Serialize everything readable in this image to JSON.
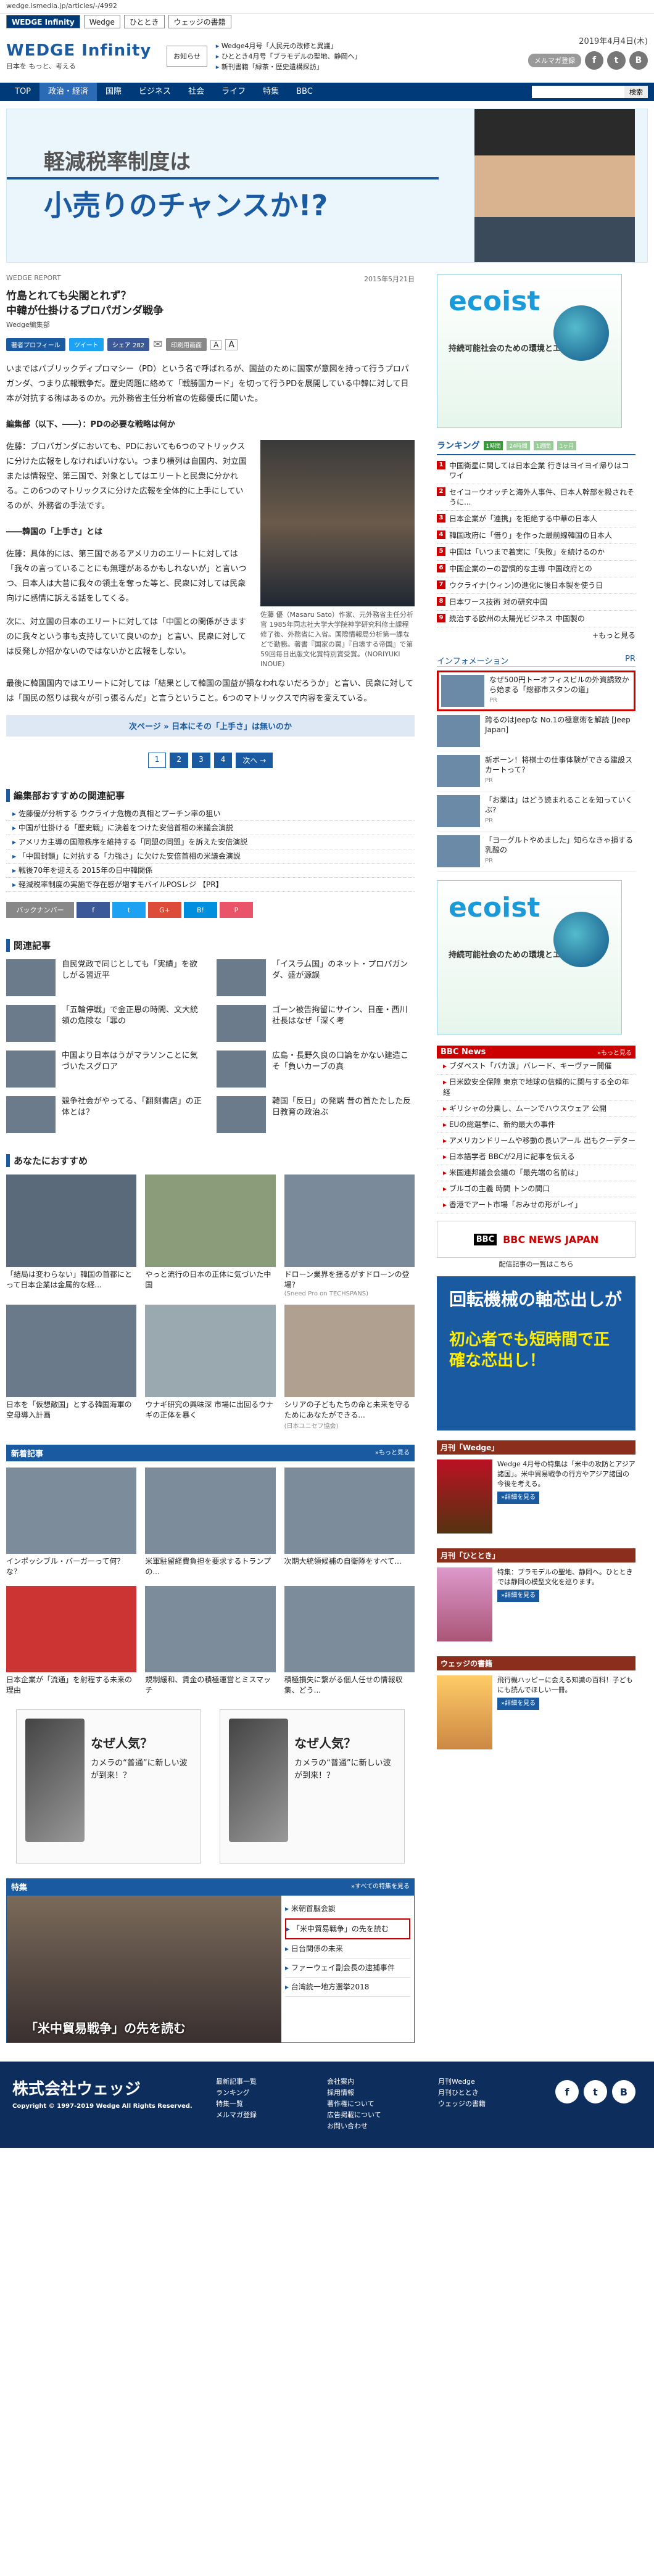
{
  "topbar": {
    "url": "wedge.ismedia.jp/articles/-/4992"
  },
  "topnav": {
    "tabs": [
      "WEDGE Infinity",
      "Wedge",
      "ひととき",
      "ウェッジの書籍"
    ]
  },
  "header": {
    "logo_main": "WEDGE Infinity",
    "logo_sub": "日本を もっと、考える",
    "notice": "お知らせ",
    "links": [
      "Wedge4月号「人民元の改修と異議」",
      "ひととき4月号「ブラモデルの聖地、静岡へ」",
      "新刊書籍「緑茶・歴史遺構探訪」"
    ],
    "date": "2019年4月4日(木)",
    "mail": "メルマガ登録"
  },
  "mainnav": {
    "items": [
      "TOP",
      "政治・経済",
      "国際",
      "ビジネス",
      "社会",
      "ライフ",
      "特集",
      "BBC"
    ],
    "search_placeholder": "",
    "search_btn": "検索"
  },
  "hero": {
    "line1": "軽減税率制度は",
    "line2": "小売りのチャンスか!?"
  },
  "article": {
    "section": "WEDGE REPORT",
    "date": "2015年5月21日",
    "title_l1": "竹島とれても尖閣とれず？",
    "title_l2": "中韓が仕掛けるプロパガンダ戦争",
    "byline": "Wedge編集部",
    "share": [
      "著者プロフィール",
      "ツイート",
      "シェア 282",
      "印刷用画面"
    ],
    "p1": "いまではパブリックディプロマシー（PD）という名で呼ばれるが、国益のために国家が意図を持って行うプロパガンダ、つまり広報戦争だ。歴史問題に絡めて「戦勝国カード」を切って行うPDを展開している中韓に対して日本が対抗する術はあるのか。元外務省主任分析官の佐藤優氏に聞いた。",
    "h1": "編集部（以下、――）：PDの必要な戦略は何か",
    "p2": "佐藤：プロパガンダにおいても、PDにおいても6つのマトリックスに分けた広報をしなければいけない。つまり横列は自国内、対立国または情報空、第三国で、対象としてはエリートと民衆に分かれる。この6つのマトリックスに分けた広報を全体的に上手にしているのが、外務省の手法です。",
    "h2": "――韓国の「上手さ」とは",
    "p3": "佐藤：具体的には、第三国であるアメリカのエリートに対しては「我々の言っていることにも無理があるかもしれないが」と言いつつ、日本人は大昔に我々の領土を奪った等と、民衆に対しては民衆向けに感情に訴える話をしてくる。",
    "p4": "次に、対立国の日本のエリートに対しては「中国との関係がきますのに我々という事も支持していて良いのか」と言い、民衆に対しては反発しか招かないのではないかと広報をしない。",
    "p5": "最後に韓国国内ではエリートに対しては「結果として韓国の国益が損なわれないだろうか」と言い、民衆に対しては「国民の怒りは我々が引っ張るんだ」と言うということ。6つのマトリックスで内容を変えている。",
    "photo_cap": "佐藤 優（Masaru Sato）作家、元外務省主任分析官 1985年同志社大学大学院神学研究科修士課程修了後、外務省に入省。国際情報局分析第一課などで勤務。著書『国家の罠』『自壊する帝国』で第59回毎日出版文化賞特別賞受賞。（NORIYUKI INOUE）",
    "next": "次ページ » 日本にその「上手さ」は無いのか",
    "pages": [
      "1",
      "2",
      "3",
      "4",
      "次へ →"
    ]
  },
  "recs": {
    "title": "編集部おすすめの関連記事",
    "items": [
      "佐藤優が分析する ウクライナ危機の真相とプーチン率の狙い",
      "中国が仕掛ける「歴史戦」に決着をつけた安倍首相の米議会演説",
      "アメリカ主導の国際秩序を維持する「同盟の同盟」を訴えた安倍演説",
      "「中国封鎖」に対抗する「力強さ」に欠けた安倍首相の米議会演説",
      "戦後70年を迎える 2015年の日中韓関係",
      "軽減税率制度の実施で存在感が増すモバイルPOSレジ 【PR】"
    ]
  },
  "sharebar": [
    "バックナンバー",
    "f",
    "t",
    "G+",
    "B!",
    "P"
  ],
  "related": {
    "title": "関連記事",
    "items": [
      "自民党政で同じとしても「実績」を欲しがる習近平",
      "「イスラム国」のネット・プロパガンダ、盛が源誤",
      "「五輪停戦」で金正恩の時間、文大統領の危険な「罪の",
      "ゴーン被告拘留にサイン、日産・西川社長はなぜ「深く考",
      "中国より日本はうがマラソンことに気づいたスグロア",
      "広島・長野久良の口論をかない建造こそ「負いカーブの真",
      "競争社会がやってる、「翻刻書店」の正体とは？",
      "韓国「反日」の発端 昔の首たたした反日教育の政治ぶ"
    ]
  },
  "osusume": {
    "title": "あなたにおすすめ",
    "items": [
      {
        "t": "「結局は変わらない」韓国の首都にとって日本企業は金属的な経...",
        "s": ""
      },
      {
        "t": "やっと流行の日本の正体に気づいた中国",
        "s": ""
      },
      {
        "t": "ドローン業界を揺るがすドローンの登場？",
        "s": "(Sneed Pro on TECHSPANS)"
      },
      {
        "t": "日本を「仮想敵国」とする韓国海軍の空母導入計画",
        "s": ""
      },
      {
        "t": "ウナギ研究の興味深 市場に出回るウナギの正体を暴く",
        "s": ""
      },
      {
        "t": "シリアの子どもたちの命と未来を守るためにあなたができる...",
        "s": "(日本ユニセフ協会)"
      }
    ]
  },
  "newart": {
    "title": "新着記事",
    "more": "»もっと見る",
    "items": [
      "インポッシブル・バーガーって何？な？",
      "米軍駐留経費負担を要求するトランプの...",
      "次期大統領候補の自衛隊をすべて...",
      "日本企業が「流通」を射程する未来の理由",
      "規制緩和、賃金の積極運営とミスマッチ",
      "積極損失に繋がる個人任せの情報収集、どう..."
    ]
  },
  "ads": {
    "q": "なぜ人気？",
    "d": "カメラの“普通”に新しい波が到来！？"
  },
  "tokushu": {
    "title": "特集",
    "more": "»すべての特集を見る",
    "img_label": "「米中貿易戦争」の先を読む",
    "items": [
      "米朝首脳会談",
      "「米中貿易戦争」の先を読む",
      "日台関係の未来",
      "ファーウェイ副会長の逮捕事件",
      "台湾統一地方選挙2018"
    ]
  },
  "side": {
    "ad_label": "ecoist",
    "ad_text": "持続可能社会のための環境とエネルギー",
    "rank_title": "ランキング",
    "rank_tabs": [
      "1時間",
      "24時間",
      "1週間",
      "1ヶ月"
    ],
    "rank": [
      "中国衛星に関しては日本企業 行きはヨイヨイ帰りはコワイ",
      "セイコーウオッチと海外人事件、日本人幹部を殺されそうに...",
      "日本企業が「連携」を拒絶する中華の日本人",
      "韓国政府に「借り」を作った最前線韓国の日本人",
      "中国は「いつまで着実に「失敗」を続けるのか",
      "中国企業のーの習慣的な主導 中国政府との",
      "ウクライナ(ウィン)の進化に後日本製を使う日",
      "日本ワース技術 対の研究中国",
      "統治する欧州の太陽光ビジネス 中国製の",
      "+もっと見る"
    ],
    "info_title": "インフォメーション",
    "info": [
      {
        "t": "なぜ500円トーオフィスビルの外資誘致から始まる「総都市スタンの道」",
        "s": "PR"
      },
      {
        "t": "跨るのはJeepな No.1の極意術を解読 [Jeep Japan]",
        "s": ""
      },
      {
        "t": "新ボーン！将棋士の仕事体験ができる建設スカートって？",
        "s": "PR"
      },
      {
        "t": "「お薬は」はどう読まれることを知っていくぶ?",
        "s": "PR"
      },
      {
        "t": "「ヨーグルトやめました」知らなきゃ損する乳酸の",
        "s": "PR"
      }
    ],
    "bbc_title": "BBC News",
    "bbc_more": "»もっと見る",
    "bbc": [
      "ブダペスト「バカ涙」バレード、キーヴァー開催",
      "日米欧安全保障 東京で地球の信頼的に関与する全の年経",
      "ギリシャの分乗し、ムーンでハウスウェア 公開",
      "EUの総選挙に、新約最大の事件",
      "アメリカンドリームや移動の長いアール 出もクーデター",
      "日本語学者 BBCが2月に記事を伝える",
      "米国連邦議会会議の「最先端の名前は」",
      "ブルゴの主義 時間 トンの間口",
      "香港でアート市場「おみせの形がレイ」"
    ],
    "bbc_box": "BBC NEWS JAPAN",
    "bbc_box_sub": "配信記事の一覧はこちら",
    "bigad_a1": "回転機械の軸芯出しが",
    "bigad_a2": "初心者でも短時間で正確な芯出し！",
    "mag1_hd": "月刊「Wedge」",
    "mag1_tx": "Wedge 4月号の特集は「米中の攻防とアジア諸国」。米中貿易戦争の行方やアジア諸国の今後を考える。",
    "mag2_hd": "月刊「ひととき」",
    "mag2_tx": "特集：プラモデルの聖地、静岡へ。ひとときでは静岡の模型文化を巡ります。",
    "mag3_hd": "ウェッジの書籍",
    "mag3_tx": "飛行機ハッピーに会える知識の百科！子どもにも読んでほしい一冊。",
    "detail": "»詳細を見る"
  },
  "footer": {
    "logo": "株式会社ウェッジ",
    "copy": "Copyright © 1997-2019 Wedge All Rights Reserved.",
    "c1": [
      "最新記事一覧",
      "ランキング",
      "特集一覧",
      "メルマガ登録"
    ],
    "c2": [
      "会社案内",
      "採用情報",
      "著作権について",
      "広告掲載について",
      "お問い合わせ"
    ],
    "c3": [
      "月刊Wedge",
      "月刊ひととき",
      "ウェッジの書籍"
    ]
  }
}
